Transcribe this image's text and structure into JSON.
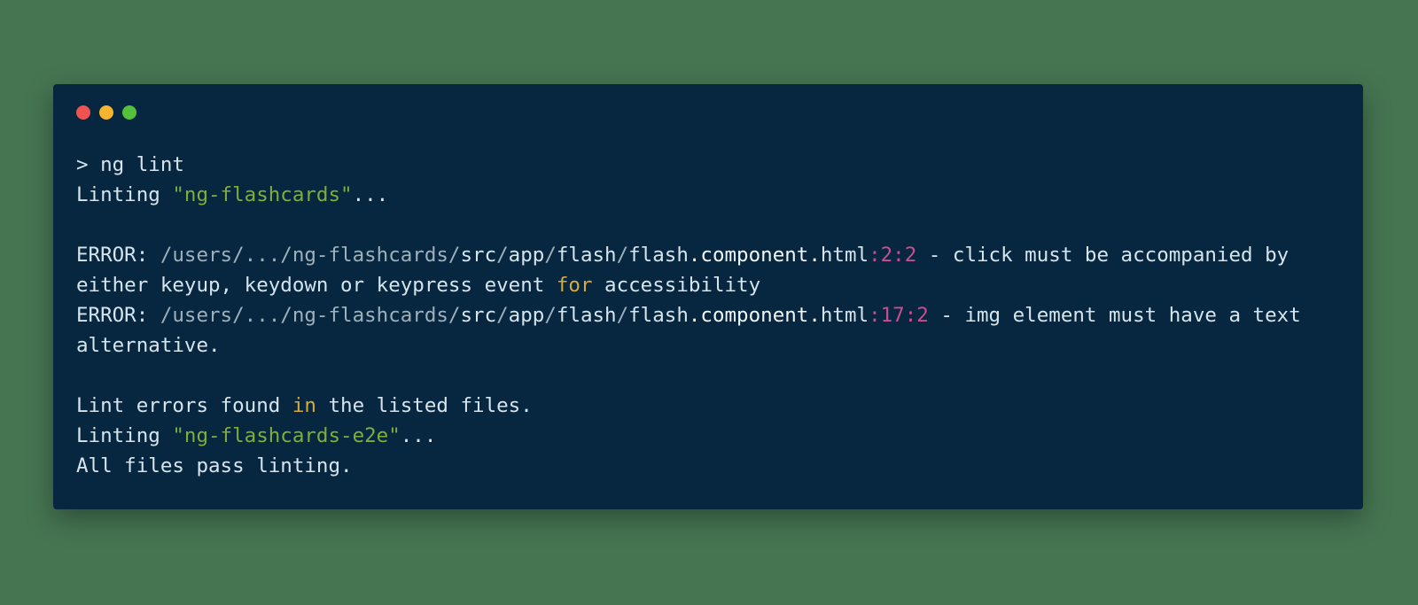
{
  "cmd": {
    "prompt": "> ",
    "text": "ng lint"
  },
  "line_linting1_a": "Linting ",
  "line_linting1_b": "\"ng-flashcards\"",
  "line_linting1_c": "...",
  "err1": {
    "label": "ERROR: ",
    "path_dim": "/users/.../ng-flashcards/",
    "path1": "src",
    "slash": "/",
    "path2": "app",
    "path3": "flash",
    "path4": "flash",
    "dot": ".",
    "path5a": "component",
    "path5b": "html",
    "colon": ":",
    "ln": "2",
    "col": "2",
    "dash": " - ",
    "msg1a": "click must be accompanied by either keyup, keydown or keypress event ",
    "kw_for": "for",
    "msg1b": " accessibility"
  },
  "err2": {
    "label": "ERROR: ",
    "path_dim": "/users/.../ng-flashcards/",
    "path1": "src",
    "slash": "/",
    "path2": "app",
    "path3": "flash",
    "path4": "flash",
    "dot": ".",
    "path5a": "component",
    "path5b": "html",
    "colon": ":",
    "ln": "17",
    "col": "2",
    "dash": " - ",
    "msg": "img element must have a text alternative."
  },
  "summary1a": "Lint errors found ",
  "summary1kw": "in",
  "summary1b": " the listed files.",
  "line_linting2_a": "Linting ",
  "line_linting2_b": "\"ng-flashcards-e2e\"",
  "line_linting2_c": "...",
  "allpass": "All files pass linting."
}
